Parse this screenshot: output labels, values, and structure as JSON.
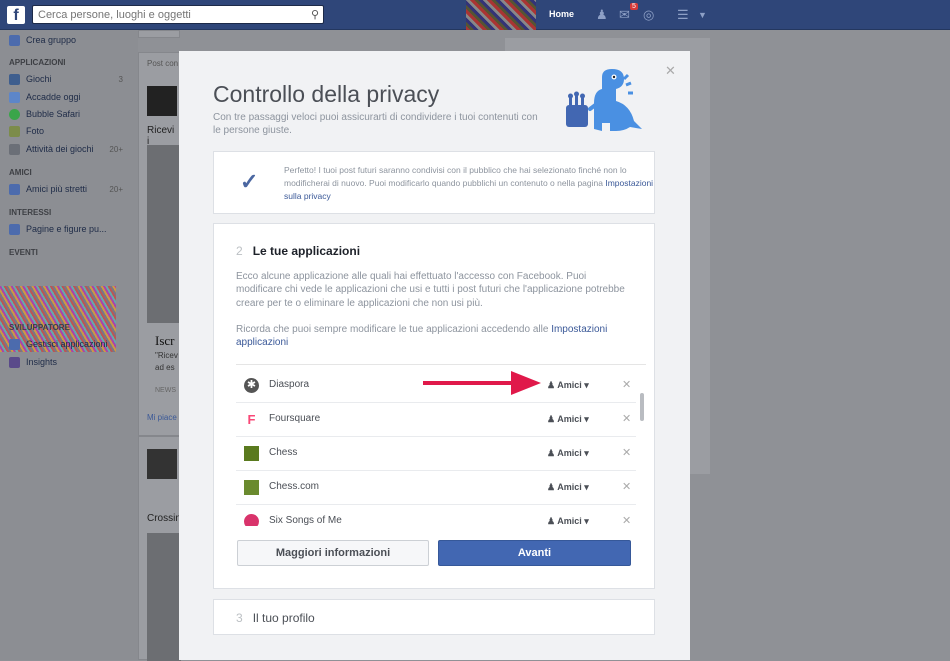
{
  "topbar": {
    "search_placeholder": "Cerca persone, luoghi e oggetti",
    "home": "Home",
    "notif_count": "5"
  },
  "sidebar": {
    "create_group": "Crea gruppo",
    "sec_apps": "APPLICAZIONI",
    "apps": [
      {
        "label": "Giochi",
        "count": "3"
      },
      {
        "label": "Accadde oggi",
        "count": ""
      },
      {
        "label": "Bubble Safari",
        "count": ""
      },
      {
        "label": "Foto",
        "count": ""
      },
      {
        "label": "Attività dei giochi",
        "count": "20+"
      }
    ],
    "sec_friends": "AMICI",
    "friends": [
      {
        "label": "Amici più stretti",
        "count": "20+"
      }
    ],
    "sec_interests": "INTERESSI",
    "interests": [
      {
        "label": "Pagine e figure pu...",
        "count": ""
      }
    ],
    "sec_events": "EVENTI",
    "sec_dev": "SVILUPPATORE",
    "dev": [
      {
        "label": "Gestisci applicazioni"
      },
      {
        "label": "Insights"
      }
    ]
  },
  "feed": {
    "post": "Post con",
    "receive": "Ricevi i",
    "iscr": "Iscr",
    "quote": "\"Ricev",
    "adesc": "ad es",
    "news": "NEWS",
    "like": "Mi piace",
    "crossing": "Crossin"
  },
  "modal": {
    "title": "Controllo della privacy",
    "subtitle": "Con tre passaggi veloci puoi assicurarti di condividere i tuoi contenuti con le persone giuste.",
    "step1_text": "Perfetto! I tuoi post futuri saranno condivisi con il pubblico che hai selezionato finché non lo modificherai di nuovo. Puoi modificarlo quando pubblichi un contenuto o nella pagina",
    "step1_link": "Impostazioni sulla privacy",
    "step2_num": "2",
    "step2_title": "Le tue applicazioni",
    "step2_desc": "Ecco alcune applicazione alle quali hai effettuato l'accesso con Facebook. Puoi modificare chi vede le applicazioni che usi e tutti i post futuri che l'applicazione potrebbe creare per te o eliminare le applicazioni che non usi più.",
    "step2_note": "Ricorda che puoi sempre modificare le tue applicazioni accedendo alle",
    "step2_note_link": "Impostazioni applicazioni",
    "apps": [
      {
        "name": "Diaspora",
        "audience": "Amici",
        "color": "#555"
      },
      {
        "name": "Foursquare",
        "audience": "Amici",
        "color": "#f94877"
      },
      {
        "name": "Chess",
        "audience": "Amici",
        "color": "#5a7a1e"
      },
      {
        "name": "Chess.com",
        "audience": "Amici",
        "color": "#6a8a2e"
      },
      {
        "name": "Six Songs of Me",
        "audience": "Amici",
        "color": "#d9336b"
      }
    ],
    "btn_more": "Maggiori informazioni",
    "btn_next": "Avanti",
    "step3_num": "3",
    "step3_title": "Il tuo profilo"
  },
  "colors": {
    "fb_blue": "#3b5998",
    "next_button": "#4267b2",
    "arrow": "#e0194a"
  }
}
